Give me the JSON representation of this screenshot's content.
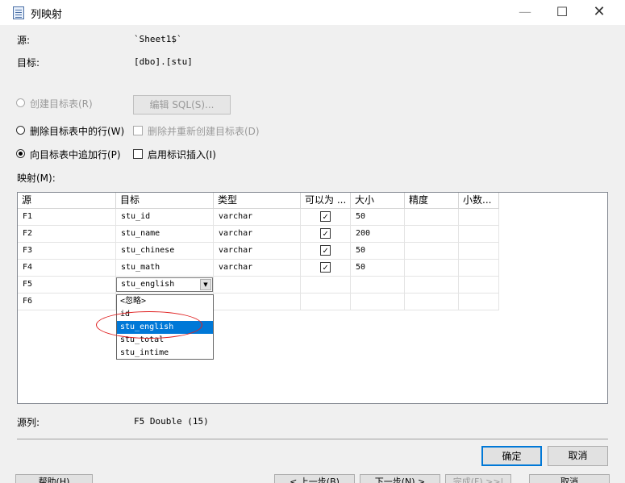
{
  "window": {
    "title": "列映射"
  },
  "info": {
    "source_label": "源:",
    "source_value": "`Sheet1$`",
    "target_label": "目标:",
    "target_value": "[dbo].[stu]"
  },
  "options": {
    "create_table": "创建目标表(R)",
    "edit_sql": "编辑 SQL(S)...",
    "delete_rows": "删除目标表中的行(W)",
    "drop_recreate": "删除并重新创建目标表(D)",
    "append_rows": "向目标表中追加行(P)",
    "identity_insert": "启用标识插入(I)"
  },
  "mappings_label": "映射(M):",
  "grid": {
    "headers": [
      "源",
      "目标",
      "类型",
      "可以为 ...",
      "大小",
      "精度",
      "小数..."
    ],
    "rows": [
      {
        "source": "F1",
        "target": "stu_id",
        "type": "varchar",
        "nullable": true,
        "size": "50"
      },
      {
        "source": "F2",
        "target": "stu_name",
        "type": "varchar",
        "nullable": true,
        "size": "200"
      },
      {
        "source": "F3",
        "target": "stu_chinese",
        "type": "varchar",
        "nullable": true,
        "size": "50"
      },
      {
        "source": "F4",
        "target": "stu_math",
        "type": "varchar",
        "nullable": true,
        "size": "50"
      },
      {
        "source": "F5",
        "target": "stu_english",
        "type": "",
        "size": ""
      },
      {
        "source": "F6",
        "target": "",
        "type": "",
        "size": ""
      }
    ]
  },
  "dropdown": {
    "options": [
      "<忽略>",
      "id",
      "stu_english",
      "stu_total",
      "stu_intime"
    ],
    "selected_index": 2
  },
  "source_column": {
    "label": "源列:",
    "value": "F5 Double (15)"
  },
  "buttons": {
    "ok": "确定",
    "cancel": "取消"
  },
  "wizard_buttons": {
    "help": "帮助(H)",
    "back": "< 上一步(B)",
    "next": "下一步(N) >",
    "finish": "完成(F) >>|",
    "cancel": "取消"
  },
  "icons": {
    "app": "column-mapping-icon",
    "check": "checkmark-icon",
    "dropdown": "chevron-down-icon"
  }
}
